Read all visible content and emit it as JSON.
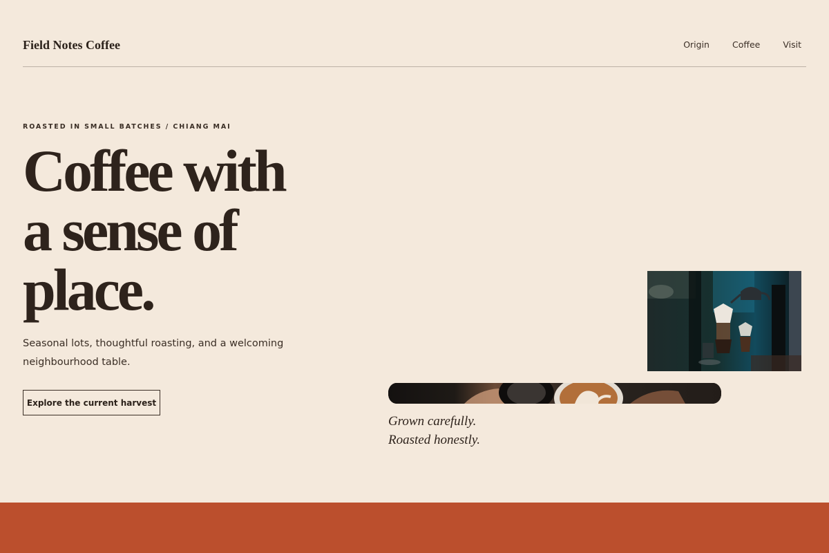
{
  "header": {
    "brand": "Field Notes Coffee",
    "nav": [
      "Origin",
      "Coffee",
      "Visit"
    ]
  },
  "hero": {
    "eyebrow": "ROASTED IN SMALL BATCHES / CHIANG MAI",
    "headline_lines": [
      "Coffee with",
      "a sense of",
      "place."
    ],
    "lede": "Seasonal lots, thoughtful roasting, and a welcoming neighbourhood table.",
    "cta_label": "Explore the current harvest"
  },
  "tagline": [
    "Grown carefully.",
    "Roasted honestly."
  ],
  "colors": {
    "background": "#f4e9dc",
    "ink": "#2b211a",
    "accent_band": "#bb4f2d"
  }
}
